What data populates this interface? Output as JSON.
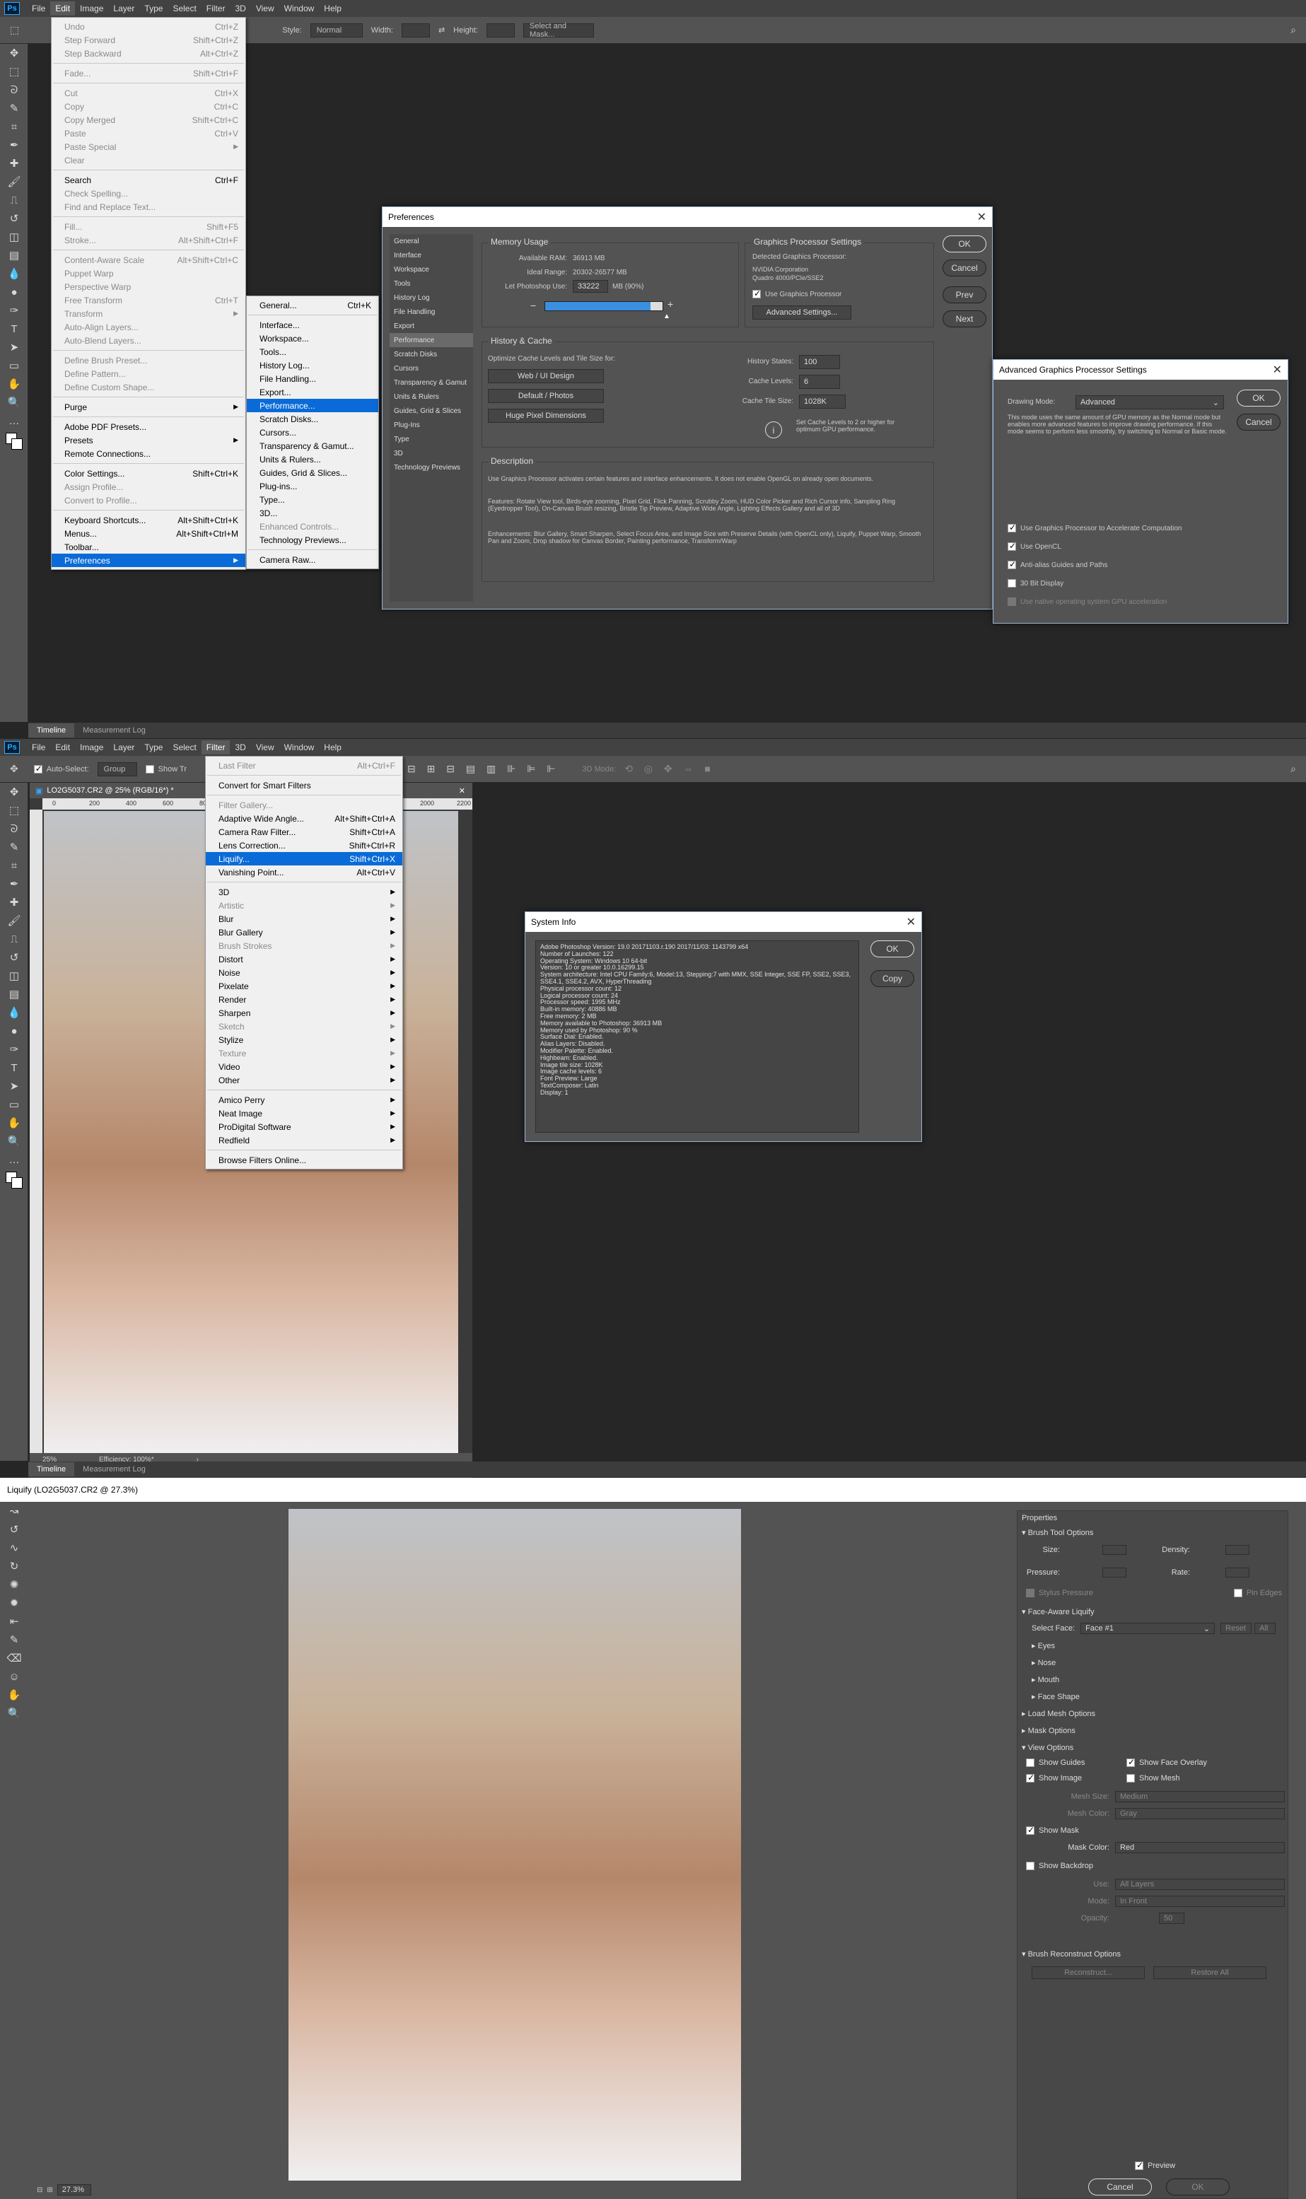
{
  "app": {
    "logo": "Ps"
  },
  "menubar1": [
    "File",
    "Edit",
    "Image",
    "Layer",
    "Type",
    "Select",
    "Filter",
    "3D",
    "View",
    "Window",
    "Help"
  ],
  "menubar2": [
    "File",
    "Edit",
    "Image",
    "Layer",
    "Type",
    "Select",
    "Filter",
    "3D",
    "View",
    "Window",
    "Help"
  ],
  "options1": {
    "style_label": "Style:",
    "style_value": "Normal",
    "width_label": "Width:",
    "height_label": "Height:",
    "select_mask": "Select and Mask..."
  },
  "options2": {
    "auto_select": "Auto-Select:",
    "group": "Group",
    "show_tr": "Show Tr",
    "mode_3d": "3D Mode:"
  },
  "edit_menu": [
    {
      "label": "Undo",
      "sc": "Ctrl+Z",
      "dis": true
    },
    {
      "label": "Step Forward",
      "sc": "Shift+Ctrl+Z",
      "dis": true
    },
    {
      "label": "Step Backward",
      "sc": "Alt+Ctrl+Z",
      "dis": true
    },
    {
      "sep": true
    },
    {
      "label": "Fade...",
      "sc": "Shift+Ctrl+F",
      "dis": true
    },
    {
      "sep": true
    },
    {
      "label": "Cut",
      "sc": "Ctrl+X",
      "dis": true
    },
    {
      "label": "Copy",
      "sc": "Ctrl+C",
      "dis": true
    },
    {
      "label": "Copy Merged",
      "sc": "Shift+Ctrl+C",
      "dis": true
    },
    {
      "label": "Paste",
      "sc": "Ctrl+V",
      "dis": true
    },
    {
      "label": "Paste Special",
      "sc": "",
      "arrow": true,
      "dis": true
    },
    {
      "label": "Clear",
      "sc": "",
      "dis": true
    },
    {
      "sep": true
    },
    {
      "label": "Search",
      "sc": "Ctrl+F"
    },
    {
      "label": "Check Spelling...",
      "sc": "",
      "dis": true
    },
    {
      "label": "Find and Replace Text...",
      "sc": "",
      "dis": true
    },
    {
      "sep": true
    },
    {
      "label": "Fill...",
      "sc": "Shift+F5",
      "dis": true
    },
    {
      "label": "Stroke...",
      "sc": "Alt+Shift+Ctrl+F",
      "dis": true
    },
    {
      "sep": true
    },
    {
      "label": "Content-Aware Scale",
      "sc": "Alt+Shift+Ctrl+C",
      "dis": true
    },
    {
      "label": "Puppet Warp",
      "sc": "",
      "dis": true
    },
    {
      "label": "Perspective Warp",
      "sc": "",
      "dis": true
    },
    {
      "label": "Free Transform",
      "sc": "Ctrl+T",
      "dis": true
    },
    {
      "label": "Transform",
      "sc": "",
      "arrow": true,
      "dis": true
    },
    {
      "label": "Auto-Align Layers...",
      "sc": "",
      "dis": true
    },
    {
      "label": "Auto-Blend Layers...",
      "sc": "",
      "dis": true
    },
    {
      "sep": true
    },
    {
      "label": "Define Brush Preset...",
      "sc": "",
      "dis": true
    },
    {
      "label": "Define Pattern...",
      "sc": "",
      "dis": true
    },
    {
      "label": "Define Custom Shape...",
      "sc": "",
      "dis": true
    },
    {
      "sep": true
    },
    {
      "label": "Purge",
      "sc": "",
      "arrow": true
    },
    {
      "sep": true
    },
    {
      "label": "Adobe PDF Presets...",
      "sc": ""
    },
    {
      "label": "Presets",
      "sc": "",
      "arrow": true
    },
    {
      "label": "Remote Connections...",
      "sc": ""
    },
    {
      "sep": true
    },
    {
      "label": "Color Settings...",
      "sc": "Shift+Ctrl+K"
    },
    {
      "label": "Assign Profile...",
      "sc": "",
      "dis": true
    },
    {
      "label": "Convert to Profile...",
      "sc": "",
      "dis": true
    },
    {
      "sep": true
    },
    {
      "label": "Keyboard Shortcuts...",
      "sc": "Alt+Shift+Ctrl+K"
    },
    {
      "label": "Menus...",
      "sc": "Alt+Shift+Ctrl+M"
    },
    {
      "label": "Toolbar...",
      "sc": ""
    },
    {
      "label": "Preferences",
      "sc": "",
      "arrow": true,
      "sel": true
    }
  ],
  "prefs_submenu": [
    {
      "label": "General...",
      "sc": "Ctrl+K"
    },
    {
      "sep": true
    },
    {
      "label": "Interface...",
      "sc": ""
    },
    {
      "label": "Workspace...",
      "sc": ""
    },
    {
      "label": "Tools...",
      "sc": ""
    },
    {
      "label": "History Log...",
      "sc": ""
    },
    {
      "label": "File Handling...",
      "sc": ""
    },
    {
      "label": "Export...",
      "sc": ""
    },
    {
      "label": "Performance...",
      "sc": "",
      "sel": true
    },
    {
      "label": "Scratch Disks...",
      "sc": ""
    },
    {
      "label": "Cursors...",
      "sc": ""
    },
    {
      "label": "Transparency & Gamut...",
      "sc": ""
    },
    {
      "label": "Units & Rulers...",
      "sc": ""
    },
    {
      "label": "Guides, Grid & Slices...",
      "sc": ""
    },
    {
      "label": "Plug-ins...",
      "sc": ""
    },
    {
      "label": "Type...",
      "sc": ""
    },
    {
      "label": "3D...",
      "sc": ""
    },
    {
      "label": "Enhanced Controls...",
      "sc": "",
      "dis": true
    },
    {
      "label": "Technology Previews...",
      "sc": ""
    },
    {
      "sep": true
    },
    {
      "label": "Camera Raw...",
      "sc": ""
    }
  ],
  "prefs": {
    "title": "Preferences",
    "nav": [
      "General",
      "Interface",
      "Workspace",
      "Tools",
      "History Log",
      "File Handling",
      "Export",
      "Performance",
      "Scratch Disks",
      "Cursors",
      "Transparency & Gamut",
      "Units & Rulers",
      "Guides, Grid & Slices",
      "Plug-Ins",
      "Type",
      "3D",
      "Technology Previews"
    ],
    "nav_selected": 7,
    "memory_title": "Memory Usage",
    "available_label": "Available RAM:",
    "available_value": "36913 MB",
    "ideal_label": "Ideal Range:",
    "ideal_value": "20302-26577 MB",
    "let_label": "Let Photoshop Use:",
    "let_value": "33222",
    "let_unit": "MB (90%)",
    "slider_fill": 0.9,
    "gpu_title": "Graphics Processor Settings",
    "gpu_detected": "Detected Graphics Processor:",
    "gpu_name1": "NVIDIA Corporation",
    "gpu_name2": "Quadro 4000/PCIe/SSE2",
    "gpu_use": "Use Graphics Processor",
    "gpu_adv": "Advanced Settings...",
    "history_title": "History & Cache",
    "optimize_label": "Optimize Cache Levels and Tile Size for:",
    "btn_web": "Web / UI Design",
    "btn_default": "Default / Photos",
    "btn_huge": "Huge Pixel Dimensions",
    "hist_states_label": "History States:",
    "hist_states": "100",
    "cache_levels_label": "Cache Levels:",
    "cache_levels": "6",
    "tile_label": "Cache Tile Size:",
    "tile_value": "1028K",
    "info_text": "Set Cache Levels to 2 or higher for optimum GPU performance.",
    "desc_title": "Description",
    "desc_p1": "Use Graphics Processor activates certain features and interface enhancements. It does not enable OpenGL on already open documents.",
    "desc_p2": "Features: Rotate View tool, Birds-eye zooming, Pixel Grid, Flick Panning, Scrubby Zoom, HUD Color Picker and Rich Cursor info, Sampling Ring (Eyedropper Tool), On-Canvas Brush resizing, Bristle Tip Preview, Adaptive Wide Angle, Lighting Effects Gallery and all of 3D",
    "desc_p3": "Enhancements: Blur Gallery, Smart Sharpen, Select Focus Area, and Image Size with Preserve Details (with OpenCL only), Liquify, Puppet Warp, Smooth Pan and Zoom, Drop shadow for Canvas Border, Painting performance, Transform/Warp",
    "ok": "OK",
    "cancel": "Cancel",
    "prev": "Prev",
    "next": "Next"
  },
  "agps": {
    "title": "Advanced Graphics Processor Settings",
    "mode_label": "Drawing Mode:",
    "mode_value": "Advanced",
    "mode_desc": "This mode uses the same amount of GPU memory as the Normal mode but enables more advanced features to improve drawing performance. If this mode seems to perform less smoothly, try switching to Normal or Basic mode.",
    "opt1": "Use Graphics Processor to Accelerate Computation",
    "opt2": "Use OpenCL",
    "opt3": "Anti-alias Guides and Paths",
    "opt4": "30 Bit Display",
    "opt5": "Use native operating system GPU acceleration",
    "ok": "OK",
    "cancel": "Cancel"
  },
  "bottom_tabs": [
    "Timeline",
    "Measurement Log"
  ],
  "doc": {
    "tab": "LO2G5037.CR2 @ 25% (RGB/16*) *",
    "zoom": "25%",
    "efficiency": "Efficiency: 100%*",
    "ruler": [
      "0",
      "200",
      "400",
      "600",
      "800",
      "1000",
      "1200",
      "1400",
      "1600",
      "1800",
      "2000",
      "2200"
    ]
  },
  "filter_menu": [
    {
      "label": "Last Filter",
      "sc": "Alt+Ctrl+F",
      "dis": true
    },
    {
      "sep": true
    },
    {
      "label": "Convert for Smart Filters",
      "sc": ""
    },
    {
      "sep": true
    },
    {
      "label": "Filter Gallery...",
      "sc": "",
      "dis": true
    },
    {
      "label": "Adaptive Wide Angle...",
      "sc": "Alt+Shift+Ctrl+A"
    },
    {
      "label": "Camera Raw Filter...",
      "sc": "Shift+Ctrl+A"
    },
    {
      "label": "Lens Correction...",
      "sc": "Shift+Ctrl+R"
    },
    {
      "label": "Liquify...",
      "sc": "Shift+Ctrl+X",
      "sel": true
    },
    {
      "label": "Vanishing Point...",
      "sc": "Alt+Ctrl+V"
    },
    {
      "sep": true
    },
    {
      "label": "3D",
      "sc": "",
      "arrow": true
    },
    {
      "label": "Artistic",
      "sc": "",
      "arrow": true,
      "dis": true
    },
    {
      "label": "Blur",
      "sc": "",
      "arrow": true
    },
    {
      "label": "Blur Gallery",
      "sc": "",
      "arrow": true
    },
    {
      "label": "Brush Strokes",
      "sc": "",
      "arrow": true,
      "dis": true
    },
    {
      "label": "Distort",
      "sc": "",
      "arrow": true
    },
    {
      "label": "Noise",
      "sc": "",
      "arrow": true
    },
    {
      "label": "Pixelate",
      "sc": "",
      "arrow": true
    },
    {
      "label": "Render",
      "sc": "",
      "arrow": true
    },
    {
      "label": "Sharpen",
      "sc": "",
      "arrow": true
    },
    {
      "label": "Sketch",
      "sc": "",
      "arrow": true,
      "dis": true
    },
    {
      "label": "Stylize",
      "sc": "",
      "arrow": true
    },
    {
      "label": "Texture",
      "sc": "",
      "arrow": true,
      "dis": true
    },
    {
      "label": "Video",
      "sc": "",
      "arrow": true
    },
    {
      "label": "Other",
      "sc": "",
      "arrow": true
    },
    {
      "sep": true
    },
    {
      "label": "Amico Perry",
      "sc": "",
      "arrow": true
    },
    {
      "label": "Neat Image",
      "sc": "",
      "arrow": true
    },
    {
      "label": "ProDigital Software",
      "sc": "",
      "arrow": true
    },
    {
      "label": "Redfield",
      "sc": "",
      "arrow": true
    },
    {
      "sep": true
    },
    {
      "label": "Browse Filters Online...",
      "sc": ""
    }
  ],
  "sysinfo": {
    "title": "System Info",
    "lines": [
      "Adobe Photoshop Version: 19.0 20171103.r.190 2017/11/03: 1143799  x64",
      "Number of Launches: 122",
      "Operating System: Windows 10 64-bit",
      "Version: 10 or greater 10.0.16299.15",
      "System architecture: Intel CPU Family:6, Model:13, Stepping:7 with MMX, SSE Integer, SSE FP, SSE2, SSE3, SSE4.1, SSE4.2, AVX, HyperThreading",
      "Physical processor count: 12",
      "Logical processor count: 24",
      "Processor speed: 1995 MHz",
      "Built-in memory: 40886 MB",
      "Free memory: 2 MB",
      "Memory available to Photoshop: 36913 MB",
      "Memory used by Photoshop: 90 %",
      "Surface Dial: Enabled.",
      "Alias Layers: Disabled.",
      "Modifier Palette: Enabled.",
      "Highbeam: Enabled.",
      "Image tile size: 1028K",
      "Image cache levels: 6",
      "Font Preview: Large",
      "TextComposer: Latin",
      "Display: 1"
    ],
    "ok": "OK",
    "copy": "Copy"
  },
  "liquify": {
    "title": "Liquify (LO2G5037.CR2 @ 27.3%)",
    "zoom": "27.3%",
    "properties": "Properties",
    "brush_opts": "Brush Tool Options",
    "size": "Size:",
    "density": "Density:",
    "pressure": "Pressure:",
    "rate": "Rate:",
    "stylus": "Stylus Pressure",
    "pin_edges": "Pin Edges",
    "fal": "Face-Aware Liquify",
    "select_face": "Select Face:",
    "face_value": "Face #1",
    "reset": "Reset",
    "all": "All",
    "eyes": "Eyes",
    "nose": "Nose",
    "mouth": "Mouth",
    "face_shape": "Face Shape",
    "load_mesh": "Load Mesh Options",
    "mask_opts": "Mask Options",
    "view_opts": "View Options",
    "show_guides": "Show Guides",
    "show_face_overlay": "Show Face Overlay",
    "show_image": "Show Image",
    "show_mesh": "Show Mesh",
    "mesh_size": "Mesh Size:",
    "mesh_size_v": "Medium",
    "mesh_color": "Mesh Color:",
    "mesh_color_v": "Gray",
    "show_mask": "Show Mask",
    "mask_color": "Mask Color:",
    "mask_color_v": "Red",
    "show_backdrop": "Show Backdrop",
    "use": "Use:",
    "use_v": "All Layers",
    "mode": "Mode:",
    "mode_v": "In Front",
    "opacity": "Opacity:",
    "opacity_v": "50",
    "brush_recon": "Brush Reconstruct Options",
    "reconstruct": "Reconstruct...",
    "restore_all": "Restore All",
    "preview": "Preview",
    "cancel": "Cancel",
    "ok": "OK"
  }
}
